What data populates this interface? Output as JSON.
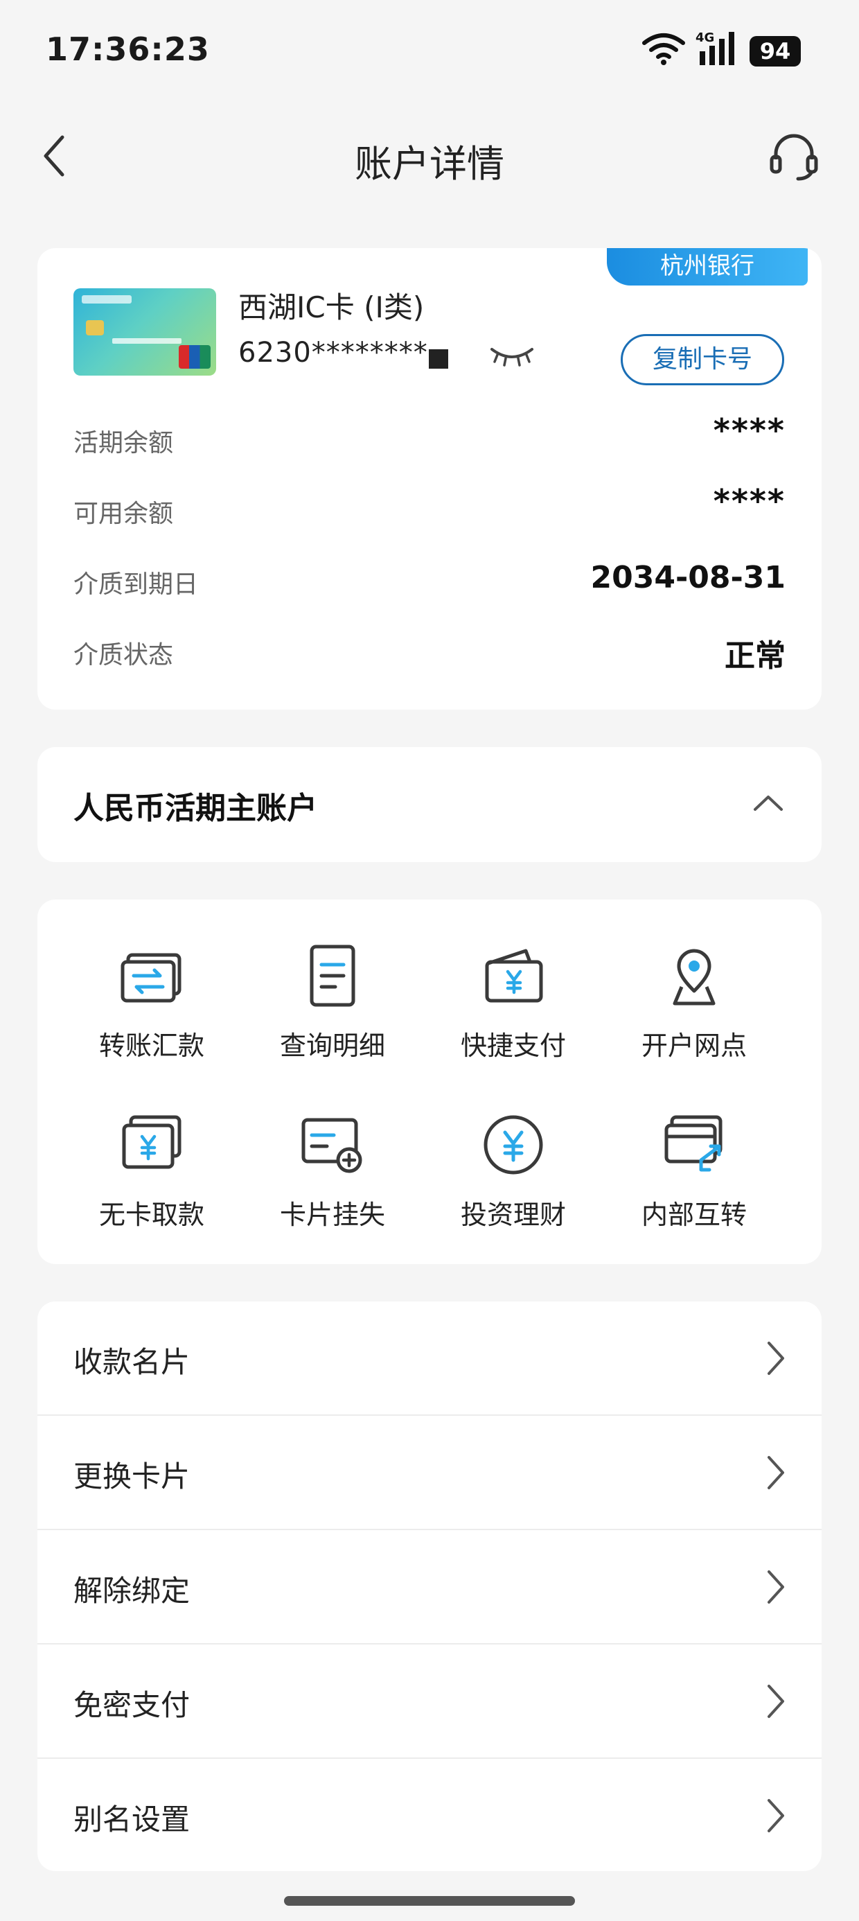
{
  "status_bar": {
    "time": "17:36:23",
    "network": "4G",
    "battery": "94"
  },
  "header": {
    "title": "账户详情"
  },
  "account": {
    "bank_badge": "杭州银行",
    "card_name": "西湖IC卡 (I类)",
    "card_number": "6230********",
    "copy_button": "复制卡号",
    "rows": [
      {
        "label": "活期余额",
        "value": "****"
      },
      {
        "label": "可用余额",
        "value": "****"
      },
      {
        "label": "介质到期日",
        "value": "2034-08-31"
      },
      {
        "label": "介质状态",
        "value": "正常"
      }
    ]
  },
  "currency_section": {
    "title": "人民币活期主账户"
  },
  "actions": [
    {
      "label": "转账汇款",
      "icon": "transfer-icon"
    },
    {
      "label": "查询明细",
      "icon": "statement-icon"
    },
    {
      "label": "快捷支付",
      "icon": "quick-pay-icon"
    },
    {
      "label": "开户网点",
      "icon": "location-pin-icon"
    },
    {
      "label": "无卡取款",
      "icon": "cardless-withdraw-icon"
    },
    {
      "label": "卡片挂失",
      "icon": "card-report-loss-icon"
    },
    {
      "label": "投资理财",
      "icon": "investment-icon"
    },
    {
      "label": "内部互转",
      "icon": "internal-transfer-icon"
    }
  ],
  "menu": [
    {
      "label": "收款名片"
    },
    {
      "label": "更换卡片"
    },
    {
      "label": "解除绑定"
    },
    {
      "label": "免密支付"
    },
    {
      "label": "别名设置"
    }
  ],
  "colors": {
    "accent": "#1a6eb5",
    "icon_blue": "#2aa8e8",
    "background": "#f5f5f5"
  }
}
